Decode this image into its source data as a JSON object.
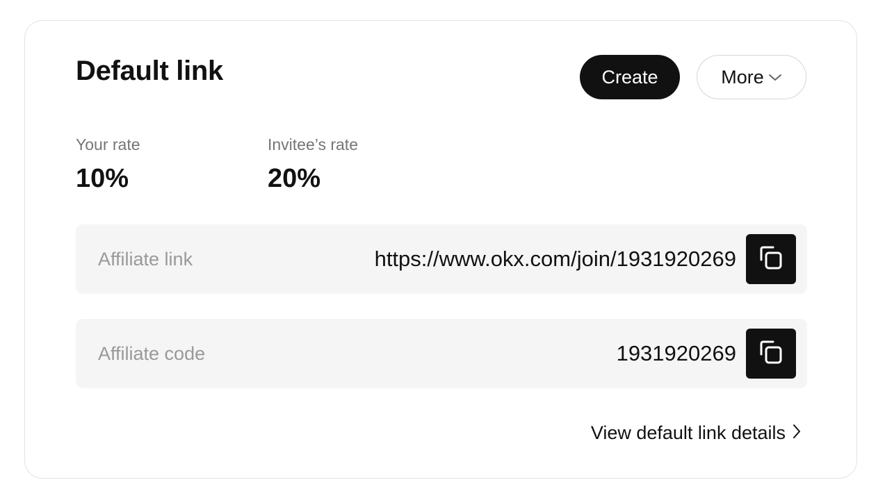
{
  "card": {
    "title": "Default link",
    "actions": {
      "create_label": "Create",
      "more_label": "More"
    }
  },
  "rates": {
    "your_rate_label": "Your rate",
    "your_rate_value": "10%",
    "invitee_rate_label": "Invitee’s rate",
    "invitee_rate_value": "20%"
  },
  "fields": {
    "affiliate_link": {
      "label": "Affiliate link",
      "value": "https://www.okx.com/join/1931920269"
    },
    "affiliate_code": {
      "label": "Affiliate code",
      "value": "1931920269"
    }
  },
  "footer": {
    "details_label": "View default link details"
  },
  "icons": {
    "more": "chevron-down-icon",
    "copy": "copy-icon",
    "details": "chevron-right-icon"
  },
  "colors": {
    "primary": "#111111",
    "field_background": "#f5f5f5",
    "muted_text": "#757575",
    "placeholder_text": "#999999"
  }
}
